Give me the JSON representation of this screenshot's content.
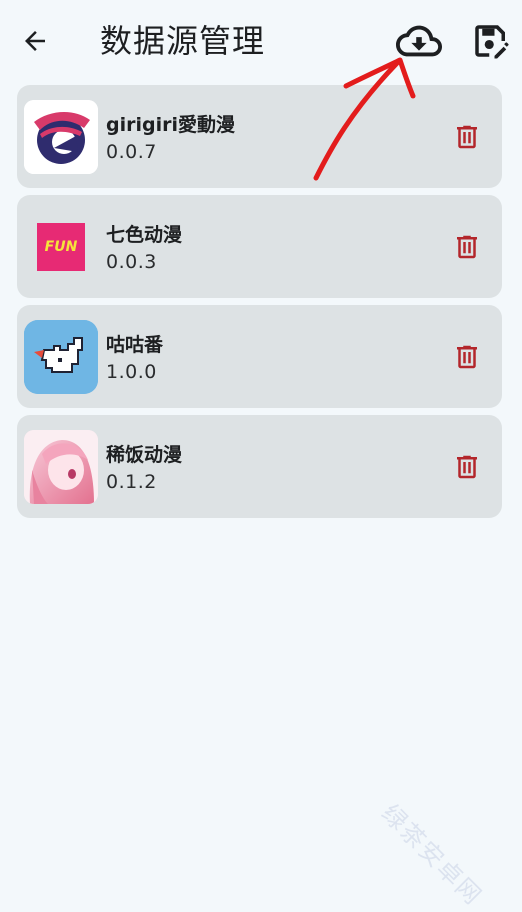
{
  "appbar": {
    "title": "数据源管理",
    "back_icon": "arrow-left-icon",
    "download_icon": "cloud-download-icon",
    "edit_icon": "save-edit-icon"
  },
  "sources": [
    {
      "name": "girigiri愛動漫",
      "version": "0.0.7",
      "icon": "girigiri-logo"
    },
    {
      "name": "七色动漫",
      "version": "0.0.3",
      "icon": "fun-logo"
    },
    {
      "name": "咕咕番",
      "version": "1.0.0",
      "icon": "pixel-bird-logo"
    },
    {
      "name": "稀饭动漫",
      "version": "0.1.2",
      "icon": "anime-girl-avatar"
    }
  ],
  "delete_icon": "trash-icon",
  "thumb_text": {
    "fun": "FUN"
  },
  "colors": {
    "background": "#f3f8fb",
    "card": "#dde2e4",
    "delete": "#b3262b",
    "annotation_arrow": "#e31c1c"
  },
  "watermark": "绿茶安卓网"
}
